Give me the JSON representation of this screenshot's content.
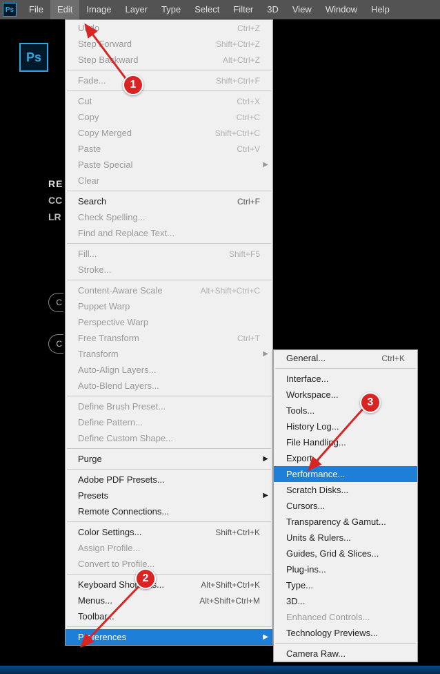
{
  "app_icon_text": "Ps",
  "logo_text": "Ps",
  "menubar": [
    "File",
    "Edit",
    "Image",
    "Layer",
    "Type",
    "Select",
    "Filter",
    "3D",
    "View",
    "Window",
    "Help"
  ],
  "active_menu_index": 1,
  "welcome": {
    "re": "RE",
    "cc": "CC",
    "lr": "LR"
  },
  "pill_text": "C",
  "badges": {
    "one": "1",
    "two": "2",
    "three": "3"
  },
  "edit_menu": [
    {
      "type": "item",
      "label": "Undo",
      "shortcut": "Ctrl+Z",
      "disabled": true
    },
    {
      "type": "item",
      "label": "Step Forward",
      "shortcut": "Shift+Ctrl+Z",
      "disabled": true
    },
    {
      "type": "item",
      "label": "Step Backward",
      "shortcut": "Alt+Ctrl+Z",
      "disabled": true
    },
    {
      "type": "sep"
    },
    {
      "type": "item",
      "label": "Fade...",
      "shortcut": "Shift+Ctrl+F",
      "disabled": true
    },
    {
      "type": "sep"
    },
    {
      "type": "item",
      "label": "Cut",
      "shortcut": "Ctrl+X",
      "disabled": true
    },
    {
      "type": "item",
      "label": "Copy",
      "shortcut": "Ctrl+C",
      "disabled": true
    },
    {
      "type": "item",
      "label": "Copy Merged",
      "shortcut": "Shift+Ctrl+C",
      "disabled": true
    },
    {
      "type": "item",
      "label": "Paste",
      "shortcut": "Ctrl+V",
      "disabled": true
    },
    {
      "type": "item",
      "label": "Paste Special",
      "submenu": true,
      "disabled": true
    },
    {
      "type": "item",
      "label": "Clear",
      "disabled": true
    },
    {
      "type": "sep"
    },
    {
      "type": "item",
      "label": "Search",
      "shortcut": "Ctrl+F"
    },
    {
      "type": "item",
      "label": "Check Spelling...",
      "disabled": true
    },
    {
      "type": "item",
      "label": "Find and Replace Text...",
      "disabled": true
    },
    {
      "type": "sep"
    },
    {
      "type": "item",
      "label": "Fill...",
      "shortcut": "Shift+F5",
      "disabled": true
    },
    {
      "type": "item",
      "label": "Stroke...",
      "disabled": true
    },
    {
      "type": "sep"
    },
    {
      "type": "item",
      "label": "Content-Aware Scale",
      "shortcut": "Alt+Shift+Ctrl+C",
      "disabled": true
    },
    {
      "type": "item",
      "label": "Puppet Warp",
      "disabled": true
    },
    {
      "type": "item",
      "label": "Perspective Warp",
      "disabled": true
    },
    {
      "type": "item",
      "label": "Free Transform",
      "shortcut": "Ctrl+T",
      "disabled": true
    },
    {
      "type": "item",
      "label": "Transform",
      "submenu": true,
      "disabled": true
    },
    {
      "type": "item",
      "label": "Auto-Align Layers...",
      "disabled": true
    },
    {
      "type": "item",
      "label": "Auto-Blend Layers...",
      "disabled": true
    },
    {
      "type": "sep"
    },
    {
      "type": "item",
      "label": "Define Brush Preset...",
      "disabled": true
    },
    {
      "type": "item",
      "label": "Define Pattern...",
      "disabled": true
    },
    {
      "type": "item",
      "label": "Define Custom Shape...",
      "disabled": true
    },
    {
      "type": "sep"
    },
    {
      "type": "item",
      "label": "Purge",
      "submenu": true
    },
    {
      "type": "sep"
    },
    {
      "type": "item",
      "label": "Adobe PDF Presets..."
    },
    {
      "type": "item",
      "label": "Presets",
      "submenu": true
    },
    {
      "type": "item",
      "label": "Remote Connections..."
    },
    {
      "type": "sep"
    },
    {
      "type": "item",
      "label": "Color Settings...",
      "shortcut": "Shift+Ctrl+K"
    },
    {
      "type": "item",
      "label": "Assign Profile...",
      "disabled": true
    },
    {
      "type": "item",
      "label": "Convert to Profile...",
      "disabled": true
    },
    {
      "type": "sep"
    },
    {
      "type": "item",
      "label": "Keyboard Shortcuts...",
      "shortcut": "Alt+Shift+Ctrl+K"
    },
    {
      "type": "item",
      "label": "Menus...",
      "shortcut": "Alt+Shift+Ctrl+M"
    },
    {
      "type": "item",
      "label": "Toolbar..."
    },
    {
      "type": "sep"
    },
    {
      "type": "item",
      "label": "Preferences",
      "submenu": true,
      "selected": true
    }
  ],
  "pref_menu": [
    {
      "type": "item",
      "label": "General...",
      "shortcut": "Ctrl+K"
    },
    {
      "type": "sep"
    },
    {
      "type": "item",
      "label": "Interface..."
    },
    {
      "type": "item",
      "label": "Workspace..."
    },
    {
      "type": "item",
      "label": "Tools..."
    },
    {
      "type": "item",
      "label": "History Log..."
    },
    {
      "type": "item",
      "label": "File Handling..."
    },
    {
      "type": "item",
      "label": "Export..."
    },
    {
      "type": "item",
      "label": "Performance...",
      "selected": true
    },
    {
      "type": "item",
      "label": "Scratch Disks..."
    },
    {
      "type": "item",
      "label": "Cursors..."
    },
    {
      "type": "item",
      "label": "Transparency & Gamut..."
    },
    {
      "type": "item",
      "label": "Units & Rulers..."
    },
    {
      "type": "item",
      "label": "Guides, Grid & Slices..."
    },
    {
      "type": "item",
      "label": "Plug-ins..."
    },
    {
      "type": "item",
      "label": "Type..."
    },
    {
      "type": "item",
      "label": "3D..."
    },
    {
      "type": "item",
      "label": "Enhanced Controls...",
      "disabled": true
    },
    {
      "type": "item",
      "label": "Technology Previews..."
    },
    {
      "type": "sep"
    },
    {
      "type": "item",
      "label": "Camera Raw..."
    }
  ]
}
